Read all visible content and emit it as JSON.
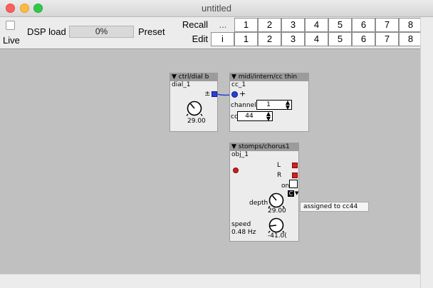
{
  "window": {
    "title": "untitled"
  },
  "toolbar": {
    "live_label": "Live",
    "dsp_label": "DSP load",
    "dsp_value": "0%",
    "preset_label": "Preset",
    "recall_label": "Recall",
    "edit_label": "Edit",
    "ellipsis": "...",
    "info_label": "i",
    "recall_buttons": [
      "1",
      "2",
      "3",
      "4",
      "5",
      "6",
      "7",
      "8"
    ],
    "edit_buttons": [
      "1",
      "2",
      "3",
      "4",
      "5",
      "6",
      "7",
      "8"
    ]
  },
  "objects": {
    "dial": {
      "header": "▼ ctrl/dial b",
      "name": "dial_1",
      "pm": "±",
      "value": "29.00"
    },
    "cc": {
      "header": "▼ midi/intern/cc thin",
      "name": "cc_1",
      "plus": "+",
      "channel_label": "channel",
      "channel_value": "1",
      "cc_label": "cc",
      "cc_value": "44"
    },
    "chorus": {
      "header": "▼ stomps/chorus1",
      "name": "obj_1",
      "l_label": "L",
      "r_label": "R",
      "on_label": "on",
      "depth_label": "depth",
      "depth_value": "29.00",
      "speed_label": "speed",
      "speed_hz": "0.48 Hz",
      "speed_value": "-41.0(",
      "c_label": "C"
    }
  },
  "tooltip": {
    "text": "assigned to cc44"
  },
  "colors": {
    "canvas": "#c0c0c0",
    "header": "#9b9b9b",
    "wire": "#2a3fd6",
    "outlet": "#d21f1f"
  }
}
